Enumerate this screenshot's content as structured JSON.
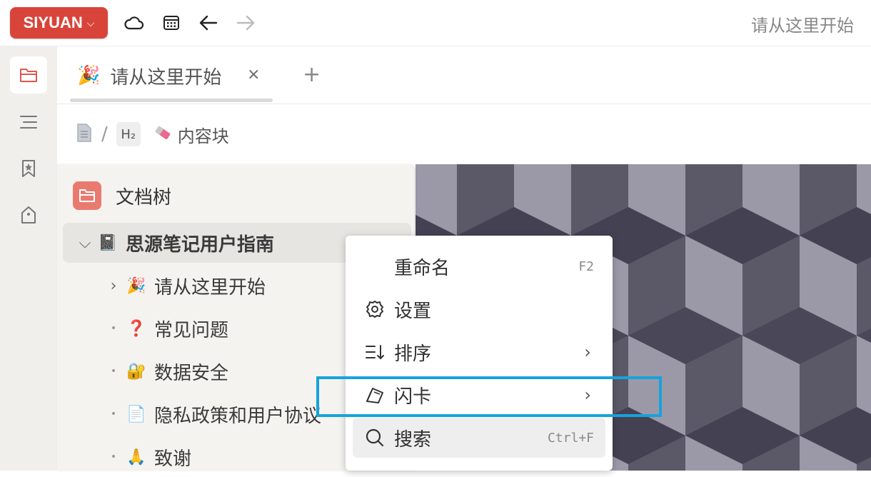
{
  "toolbar": {
    "brand": "SIYUAN",
    "title": "请从这里开始",
    "icons": [
      "cloud-icon",
      "calendar-icon",
      "back-arrow-icon",
      "forward-arrow-icon"
    ]
  },
  "dock": {
    "items": [
      "file-tree-icon",
      "outline-icon",
      "bookmark-icon",
      "tag-icon"
    ]
  },
  "tab": {
    "emoji": "🎉",
    "label": "请从这里开始",
    "close": "×",
    "add": "+"
  },
  "breadcrumb": {
    "separator": "/",
    "heading": "H₂",
    "block": "内容块"
  },
  "tree": {
    "title": "文档树",
    "root": {
      "emoji": "📓",
      "label": "思源笔记用户指南"
    },
    "items": [
      {
        "emoji": "🎉",
        "label": "请从这里开始",
        "expandable": true
      },
      {
        "emoji": "❓",
        "label": "常见问题",
        "expandable": false
      },
      {
        "emoji": "🔐",
        "label": "数据安全",
        "expandable": false
      },
      {
        "emoji": "📄",
        "label": "隐私政策和用户协议",
        "expandable": false
      },
      {
        "emoji": "🙏",
        "label": "致谢",
        "expandable": false
      }
    ]
  },
  "menu": {
    "rename": {
      "label": "重命名",
      "shortcut": "F2"
    },
    "settings": {
      "label": "设置"
    },
    "sort": {
      "label": "排序"
    },
    "flashcard": {
      "label": "闪卡"
    },
    "search": {
      "label": "搜索",
      "shortcut": "Ctrl+F"
    }
  },
  "colors": {
    "brand": "#d9443a",
    "highlight": "#17a2dd",
    "tree_icon_bg": "#e97a70"
  }
}
